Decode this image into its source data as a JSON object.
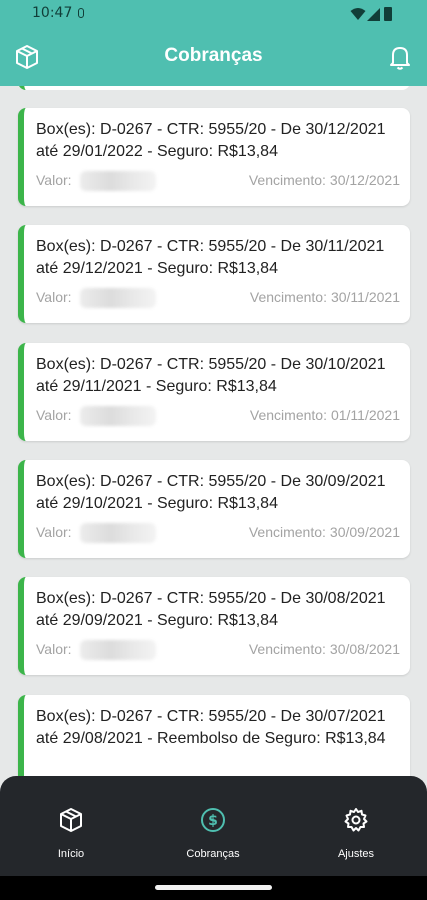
{
  "status_bar": {
    "time": "10:47"
  },
  "app_bar": {
    "title": "Cobranças"
  },
  "charges": [
    {
      "description": "Box(es): D-0267 - CTR: 5955/20 - De 30/12/2021 até 29/01/2022 - Seguro: R$13,84",
      "valor_label": "Valor:",
      "vencimento_label": "Vencimento:",
      "vencimento": "30/12/2021"
    },
    {
      "description": "Box(es): D-0267 - CTR: 5955/20 - De 30/11/2021 até 29/12/2021 - Seguro: R$13,84",
      "valor_label": "Valor:",
      "vencimento_label": "Vencimento:",
      "vencimento": "30/11/2021"
    },
    {
      "description": "Box(es): D-0267 - CTR: 5955/20 - De 30/10/2021 até 29/11/2021 - Seguro: R$13,84",
      "valor_label": "Valor:",
      "vencimento_label": "Vencimento:",
      "vencimento": "01/11/2021"
    },
    {
      "description": "Box(es): D-0267 - CTR: 5955/20 - De 30/09/2021 até 29/10/2021 - Seguro: R$13,84",
      "valor_label": "Valor:",
      "vencimento_label": "Vencimento:",
      "vencimento": "30/09/2021"
    },
    {
      "description": "Box(es): D-0267 - CTR: 5955/20 - De 30/08/2021 até 29/09/2021 - Seguro: R$13,84",
      "valor_label": "Valor:",
      "vencimento_label": "Vencimento:",
      "vencimento": "30/08/2021"
    },
    {
      "description": "Box(es): D-0267 - CTR: 5955/20 - De 30/07/2021 até 29/08/2021 - Reembolso de Seguro: R$13,84"
    }
  ],
  "bottom_nav": {
    "items": [
      {
        "label": "Início",
        "icon": "box-icon"
      },
      {
        "label": "Cobranças",
        "icon": "dollar-circle-icon",
        "active": true
      },
      {
        "label": "Ajustes",
        "icon": "gear-icon"
      }
    ]
  },
  "colors": {
    "primary": "#4fbfb0",
    "accent_bar": "#3cb54a",
    "nav_bg": "#24272b",
    "active_icon": "#4fbfb0"
  }
}
